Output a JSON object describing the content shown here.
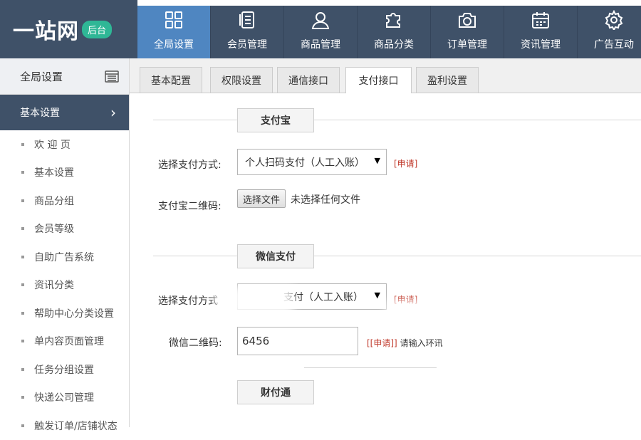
{
  "app": {
    "logo_text": "一站网",
    "logo_badge": "后台"
  },
  "nav": [
    {
      "label": "全局设置",
      "icon": "grid-icon",
      "active": true
    },
    {
      "label": "会员管理",
      "icon": "document-icon",
      "active": false
    },
    {
      "label": "商品管理",
      "icon": "user-icon",
      "active": false
    },
    {
      "label": "商品分类",
      "icon": "puzzle-icon",
      "active": false
    },
    {
      "label": "订单管理",
      "icon": "camera-icon",
      "active": false
    },
    {
      "label": "资讯管理",
      "icon": "calendar-icon",
      "active": false
    },
    {
      "label": "广告互动",
      "icon": "gear-icon",
      "active": false
    }
  ],
  "sidebar": {
    "header": "全局设置",
    "header_icon": "calendar-icon",
    "section": "基本设置",
    "items": [
      {
        "label": "欢 迎 页"
      },
      {
        "label": "基本设置"
      },
      {
        "label": "商品分组"
      },
      {
        "label": "会员等级"
      },
      {
        "label": "自助广告系统"
      },
      {
        "label": "资讯分类"
      },
      {
        "label": "帮助中心分类设置"
      },
      {
        "label": "单内容页面管理"
      },
      {
        "label": "任务分组设置"
      },
      {
        "label": "快递公司管理"
      },
      {
        "label": "触发订单/店铺状态"
      }
    ]
  },
  "tabs": [
    {
      "label": "基本配置",
      "active": false
    },
    {
      "label": "权限设置",
      "active": false
    },
    {
      "label": "通信接口",
      "active": false
    },
    {
      "label": "支付接口",
      "active": true
    },
    {
      "label": "盈利设置",
      "active": false
    }
  ],
  "alipay": {
    "title": "支付宝",
    "method_label": "选择支付方式:",
    "method_value": "个人扫码支付（人工入账）",
    "apply": "[申请]",
    "qr_label": "支付宝二维码:",
    "file_button": "选择文件",
    "file_status": "未选择任何文件"
  },
  "wechat": {
    "title": "微信支付",
    "method_label": "选择支付方式",
    "method_value": "支付（人工入账）",
    "apply": "[申请]",
    "qr_label": "微信二维码:",
    "qr_value": "6456",
    "hint_apply": "[[申请]]",
    "hint_text": "请输入环讯"
  },
  "tenpay": {
    "title": "财付通"
  },
  "colors": {
    "topbar": "#3f5168",
    "nav_active": "#4f86c1",
    "badge": "#2fb796",
    "apply_red": "#c0392b"
  }
}
